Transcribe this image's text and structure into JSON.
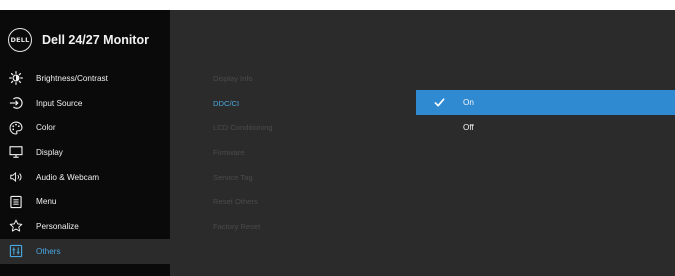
{
  "header": {
    "brand": "DELL",
    "model": "Dell 24/27 Monitor"
  },
  "menu": [
    {
      "label": "Brightness/Contrast",
      "icon": "sun-icon"
    },
    {
      "label": "Input Source",
      "icon": "input-source-icon"
    },
    {
      "label": "Color",
      "icon": "palette-icon"
    },
    {
      "label": "Display",
      "icon": "monitor-icon"
    },
    {
      "label": "Audio & Webcam",
      "icon": "speaker-icon"
    },
    {
      "label": "Menu",
      "icon": "menu-list-icon"
    },
    {
      "label": "Personalize",
      "icon": "star-icon"
    },
    {
      "label": "Others",
      "icon": "others-icon",
      "selected": true
    }
  ],
  "submenu": [
    {
      "label": "Display Info"
    },
    {
      "label": "DDC/CI",
      "active": true
    },
    {
      "label": "LCD Conditioning"
    },
    {
      "label": "Firmware"
    },
    {
      "label": "Service Tag"
    },
    {
      "label": "Reset Others"
    },
    {
      "label": "Factory Reset"
    }
  ],
  "options": [
    {
      "label": "On",
      "selected": true
    },
    {
      "label": "Off"
    }
  ],
  "colors": {
    "accent": "#2f8ad2",
    "highlight_text": "#4aa6e0",
    "panel": "#2b2b2b",
    "sidebar": "#0a0a0a"
  }
}
